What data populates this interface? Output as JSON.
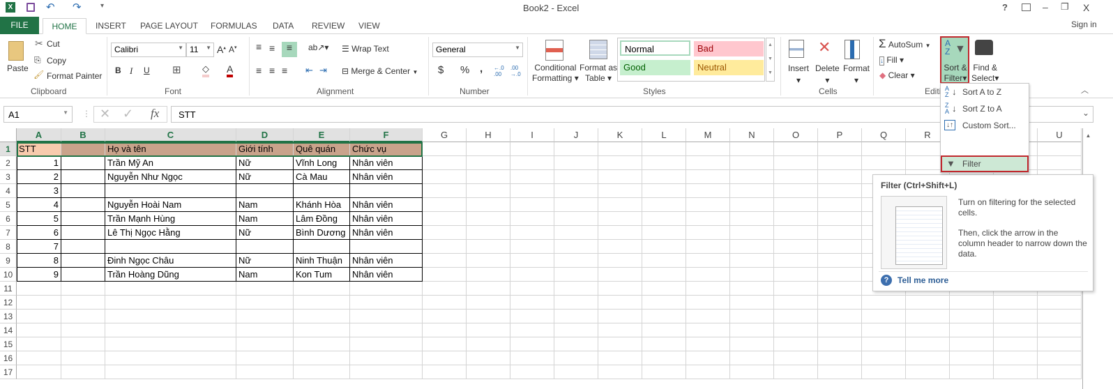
{
  "window": {
    "title": "Book2 - Excel",
    "sign_in": "Sign in"
  },
  "quick_access": {
    "icons": [
      "excel-logo-icon",
      "save-icon",
      "undo-icon",
      "redo-icon",
      "customize-icon"
    ]
  },
  "window_controls": {
    "help": "?",
    "minimize": "–",
    "restore": "❐",
    "close": "X"
  },
  "tabs": [
    {
      "label": "FILE"
    },
    {
      "label": "HOME",
      "active": true
    },
    {
      "label": "INSERT"
    },
    {
      "label": "PAGE LAYOUT"
    },
    {
      "label": "FORMULAS"
    },
    {
      "label": "DATA"
    },
    {
      "label": "REVIEW"
    },
    {
      "label": "VIEW"
    }
  ],
  "ribbon": {
    "clipboard": {
      "label": "Clipboard",
      "paste": "Paste",
      "cut": "Cut",
      "copy": "Copy",
      "format_painter": "Format Painter"
    },
    "font": {
      "label": "Font",
      "font_name": "Calibri",
      "font_size": "11",
      "bold": "B",
      "italic": "I",
      "underline": "U",
      "font_color": "#c00000"
    },
    "alignment": {
      "label": "Alignment",
      "wrap_text": "Wrap Text",
      "merge_center": "Merge & Center"
    },
    "number": {
      "label": "Number",
      "format": "General",
      "currency": "$",
      "percent": "%",
      "comma": ","
    },
    "styles": {
      "label": "Styles",
      "conditional_formatting": [
        "Conditional",
        "Formatting"
      ],
      "format_as_table": [
        "Format as",
        "Table"
      ],
      "cells": [
        {
          "label": "Normal",
          "bg": "#ffffff",
          "color": "#000000"
        },
        {
          "label": "Bad",
          "bg": "#ffc7ce",
          "color": "#9c0006"
        },
        {
          "label": "Good",
          "bg": "#c6efce",
          "color": "#006100"
        },
        {
          "label": "Neutral",
          "bg": "#ffeb9c",
          "color": "#9c5700"
        }
      ]
    },
    "cells": {
      "label": "Cells",
      "insert": "Insert",
      "delete": "Delete",
      "format": "Format"
    },
    "editing": {
      "label": "Editi",
      "autosum": "AutoSum",
      "fill": "Fill",
      "clear": "Clear",
      "sort_filter": [
        "Sort &",
        "Filter"
      ],
      "find_select": [
        "Find &",
        "Select"
      ]
    }
  },
  "formula_bar": {
    "name_box": "A1",
    "cancel": "✕",
    "enter": "✓",
    "fx": "fx",
    "value": "STT"
  },
  "sheet": {
    "columns": [
      "A",
      "B",
      "C",
      "D",
      "E",
      "F",
      "G",
      "H",
      "I",
      "J",
      "K",
      "L",
      "M",
      "N",
      "O",
      "P",
      "Q",
      "R",
      "S",
      "T",
      "U"
    ],
    "row_numbers": [
      "1",
      "2",
      "3",
      "4",
      "5",
      "6",
      "7",
      "8",
      "9",
      "10",
      "11",
      "12",
      "13",
      "14",
      "15",
      "16",
      "17"
    ],
    "header_row": [
      "STT",
      "",
      "Họ và tên",
      "Giới tính",
      "Quê quán",
      "Chức vụ"
    ],
    "header_colors": {
      "a1": "#f8cbad",
      "rest": "#c9a38b"
    },
    "rows": [
      [
        "1",
        "",
        "Trần Mỹ An",
        "Nữ",
        "Vĩnh Long",
        "Nhân viên"
      ],
      [
        "2",
        "",
        "Nguyễn Như Ngọc",
        "Nữ",
        "Cà Mau",
        "Nhân viên"
      ],
      [
        "3",
        "",
        "",
        "",
        "",
        ""
      ],
      [
        "4",
        "",
        "Nguyễn Hoài Nam",
        "Nam",
        "Khánh Hòa",
        "Nhân viên"
      ],
      [
        "5",
        "",
        "Trần Mạnh Hùng",
        "Nam",
        "Lâm Đồng",
        "Nhân viên"
      ],
      [
        "6",
        "",
        "Lê Thị Ngọc Hằng",
        "Nữ",
        "Bình Dương",
        "Nhân viên"
      ],
      [
        "7",
        "",
        "",
        "",
        "",
        ""
      ],
      [
        "8",
        "",
        "Đinh Ngọc Châu",
        "Nữ",
        "Ninh Thuận",
        "Nhân viên"
      ],
      [
        "9",
        "",
        "Trần Hoàng Dũng",
        "Nam",
        "Kon Tum",
        "Nhân viên"
      ]
    ]
  },
  "sort_filter_menu": {
    "items": [
      {
        "label": "Sort A to Z",
        "icon": "sort-a-z-icon"
      },
      {
        "label": "Sort Z to A",
        "icon": "sort-z-a-icon"
      },
      {
        "label": "Custom Sort...",
        "icon": "custom-sort-icon"
      },
      {
        "label": "Filter",
        "icon": "filter-icon",
        "highlighted": true
      }
    ]
  },
  "tooltip": {
    "title": "Filter (Ctrl+Shift+L)",
    "text1": "Turn on filtering for the selected cells.",
    "text2": "Then, click the arrow in the column header to narrow down the data.",
    "link": "Tell me more"
  },
  "colors": {
    "accent": "#217346",
    "highlight_border": "#c0282d",
    "menu_highlight": "#cde8d5"
  }
}
